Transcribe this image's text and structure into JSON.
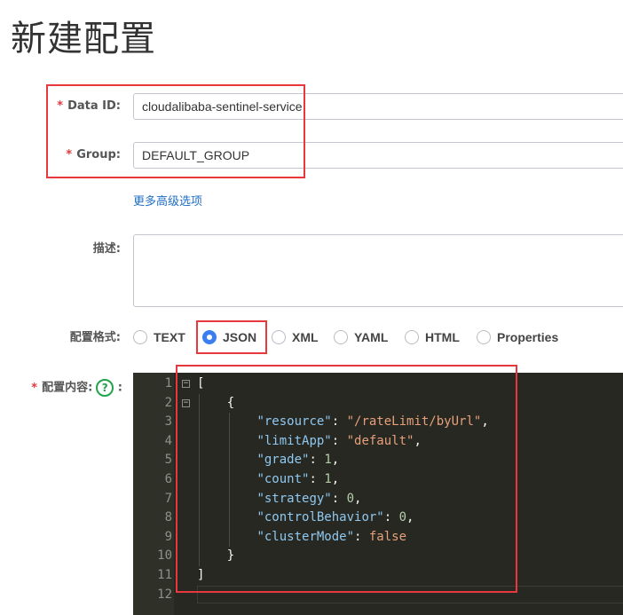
{
  "page": {
    "title": "新建配置"
  },
  "form": {
    "data_id": {
      "label": "Data ID:",
      "required_mark": "*",
      "value": "cloudalibaba-sentinel-service"
    },
    "group": {
      "label": "Group:",
      "required_mark": "*",
      "value": "DEFAULT_GROUP"
    },
    "advanced_link": "更多高级选项",
    "description": {
      "label": "描述:",
      "value": ""
    },
    "format": {
      "label": "配置格式:",
      "options": [
        "TEXT",
        "JSON",
        "XML",
        "YAML",
        "HTML",
        "Properties"
      ],
      "selected": "JSON"
    },
    "content": {
      "label": "配置内容:",
      "required_mark": "*",
      "help_glyph": "?",
      "colon": ":"
    }
  },
  "editor": {
    "line_numbers": [
      "1",
      "2",
      "3",
      "4",
      "5",
      "6",
      "7",
      "8",
      "9",
      "10",
      "11",
      "12"
    ],
    "fold_glyph": "−",
    "lines": [
      [
        {
          "t": "[",
          "c": "p"
        }
      ],
      [
        {
          "t": "    {",
          "c": "p"
        }
      ],
      [
        {
          "t": "        ",
          "c": "p"
        },
        {
          "t": "\"resource\"",
          "c": "k"
        },
        {
          "t": ": ",
          "c": "p"
        },
        {
          "t": "\"/rateLimit/byUrl\"",
          "c": "s"
        },
        {
          "t": ",",
          "c": "p"
        }
      ],
      [
        {
          "t": "        ",
          "c": "p"
        },
        {
          "t": "\"limitApp\"",
          "c": "k"
        },
        {
          "t": ": ",
          "c": "p"
        },
        {
          "t": "\"default\"",
          "c": "s"
        },
        {
          "t": ",",
          "c": "p"
        }
      ],
      [
        {
          "t": "        ",
          "c": "p"
        },
        {
          "t": "\"grade\"",
          "c": "k"
        },
        {
          "t": ": ",
          "c": "p"
        },
        {
          "t": "1",
          "c": "n"
        },
        {
          "t": ",",
          "c": "p"
        }
      ],
      [
        {
          "t": "        ",
          "c": "p"
        },
        {
          "t": "\"count\"",
          "c": "k"
        },
        {
          "t": ": ",
          "c": "p"
        },
        {
          "t": "1",
          "c": "n"
        },
        {
          "t": ",",
          "c": "p"
        }
      ],
      [
        {
          "t": "        ",
          "c": "p"
        },
        {
          "t": "\"strategy\"",
          "c": "k"
        },
        {
          "t": ": ",
          "c": "p"
        },
        {
          "t": "0",
          "c": "n"
        },
        {
          "t": ",",
          "c": "p"
        }
      ],
      [
        {
          "t": "        ",
          "c": "p"
        },
        {
          "t": "\"controlBehavior\"",
          "c": "k"
        },
        {
          "t": ": ",
          "c": "p"
        },
        {
          "t": "0",
          "c": "n"
        },
        {
          "t": ",",
          "c": "p"
        }
      ],
      [
        {
          "t": "        ",
          "c": "p"
        },
        {
          "t": "\"clusterMode\"",
          "c": "k"
        },
        {
          "t": ": ",
          "c": "p"
        },
        {
          "t": "false",
          "c": "kw"
        }
      ],
      [
        {
          "t": "    }",
          "c": "p"
        }
      ],
      [
        {
          "t": "]",
          "c": "p"
        }
      ],
      [
        {
          "t": "",
          "c": "p"
        }
      ]
    ]
  },
  "colors": {
    "accent": "#3b7ef0",
    "link": "#1f6fc4",
    "required": "#e4393c",
    "highlight_box": "#e8383d",
    "help_icon": "#23a34b",
    "editor_bg": "#272822"
  }
}
